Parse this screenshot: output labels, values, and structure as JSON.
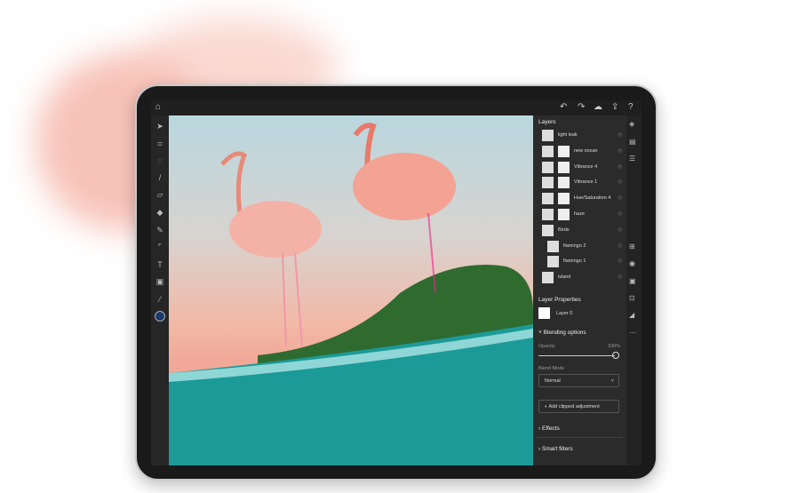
{
  "topbar": {
    "home_icon": "home-icon",
    "undo_icon": "undo-icon",
    "redo_icon": "redo-icon",
    "cloud_icon": "cloud-icon",
    "share_icon": "share-icon",
    "help_icon": "help-icon"
  },
  "tools": [
    "move",
    "transform",
    "lasso",
    "brush",
    "eraser",
    "fill",
    "healing",
    "crop",
    "text",
    "image",
    "eyedropper"
  ],
  "layers": {
    "title": "Layers",
    "items": [
      {
        "name": "light leak",
        "indent": 0
      },
      {
        "name": "new ocean",
        "indent": 0
      },
      {
        "name": "Vibrance 4",
        "indent": 0
      },
      {
        "name": "Vibrance 1",
        "indent": 0
      },
      {
        "name": "Hue/Saturation 4",
        "indent": 0
      },
      {
        "name": "haze",
        "indent": 0
      },
      {
        "name": "Birds",
        "indent": 0
      },
      {
        "name": "flamingo 2",
        "indent": 1
      },
      {
        "name": "flamingo 1",
        "indent": 1
      },
      {
        "name": "island",
        "indent": 0
      }
    ]
  },
  "properties": {
    "title": "Layer Properties",
    "layer_name": "Layer 0",
    "blending_label": "Blending options",
    "opacity_label": "Opacity",
    "opacity_value": "100%",
    "opacity": 1.0,
    "blend_mode_label": "Blend Mode",
    "blend_mode": "Normal",
    "add_clipped": "Add clipped adjustment",
    "effects": "Effects",
    "smart_filters": "Smart filters"
  },
  "colors": {
    "accent": "#1b3a6b",
    "panel": "#2b2b2b"
  }
}
